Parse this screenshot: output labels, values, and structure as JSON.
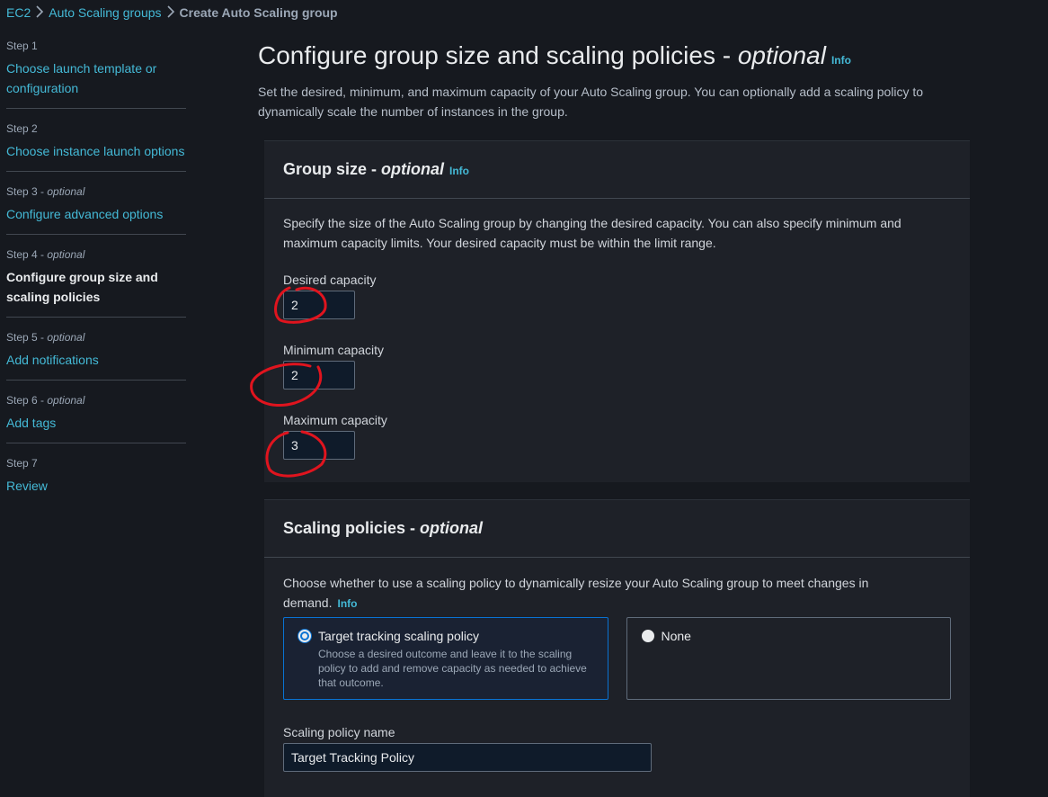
{
  "breadcrumb": {
    "items": [
      "EC2",
      "Auto Scaling groups"
    ],
    "current": "Create Auto Scaling group"
  },
  "sidebar": {
    "steps": [
      {
        "label": "Step 1",
        "optional": "",
        "title": "Choose launch template or configuration"
      },
      {
        "label": "Step 2",
        "optional": "",
        "title": "Choose instance launch options"
      },
      {
        "label": "Step 3 - ",
        "optional": "optional",
        "title": "Configure advanced options"
      },
      {
        "label": "Step 4 - ",
        "optional": "optional",
        "title": "Configure group size and scaling policies"
      },
      {
        "label": "Step 5 - ",
        "optional": "optional",
        "title": "Add notifications"
      },
      {
        "label": "Step 6 - ",
        "optional": "optional",
        "title": "Add tags"
      },
      {
        "label": "Step 7",
        "optional": "",
        "title": "Review"
      }
    ]
  },
  "main": {
    "title": "Configure group size and scaling policies - ",
    "title_optional": "optional",
    "info": "Info",
    "description": "Set the desired, minimum, and maximum capacity of your Auto Scaling group. You can optionally add a scaling policy to dynamically scale the number of instances in the group."
  },
  "group_size": {
    "title": "Group size - ",
    "title_optional": "optional",
    "info": "Info",
    "description": "Specify the size of the Auto Scaling group by changing the desired capacity. You can also specify minimum and maximum capacity limits. Your desired capacity must be within the limit range.",
    "desired_label": "Desired capacity",
    "desired_value": "2",
    "min_label": "Minimum capacity",
    "min_value": "2",
    "max_label": "Maximum capacity",
    "max_value": "3"
  },
  "scaling_policies": {
    "title": "Scaling policies - ",
    "title_optional": "optional",
    "description": "Choose whether to use a scaling policy to dynamically resize your Auto Scaling group to meet changes in demand.",
    "info": "Info",
    "option_target_title": "Target tracking scaling policy",
    "option_target_desc": "Choose a desired outcome and leave it to the scaling policy to add and remove capacity as needed to achieve that outcome.",
    "option_none_title": "None",
    "policy_name_label": "Scaling policy name",
    "policy_name_value": "Target Tracking Policy"
  },
  "colors": {
    "background": "#16191f",
    "container": "#1e2128",
    "link": "#44b9d6",
    "selected": "#0972d3",
    "annotation": "#e0141e"
  }
}
